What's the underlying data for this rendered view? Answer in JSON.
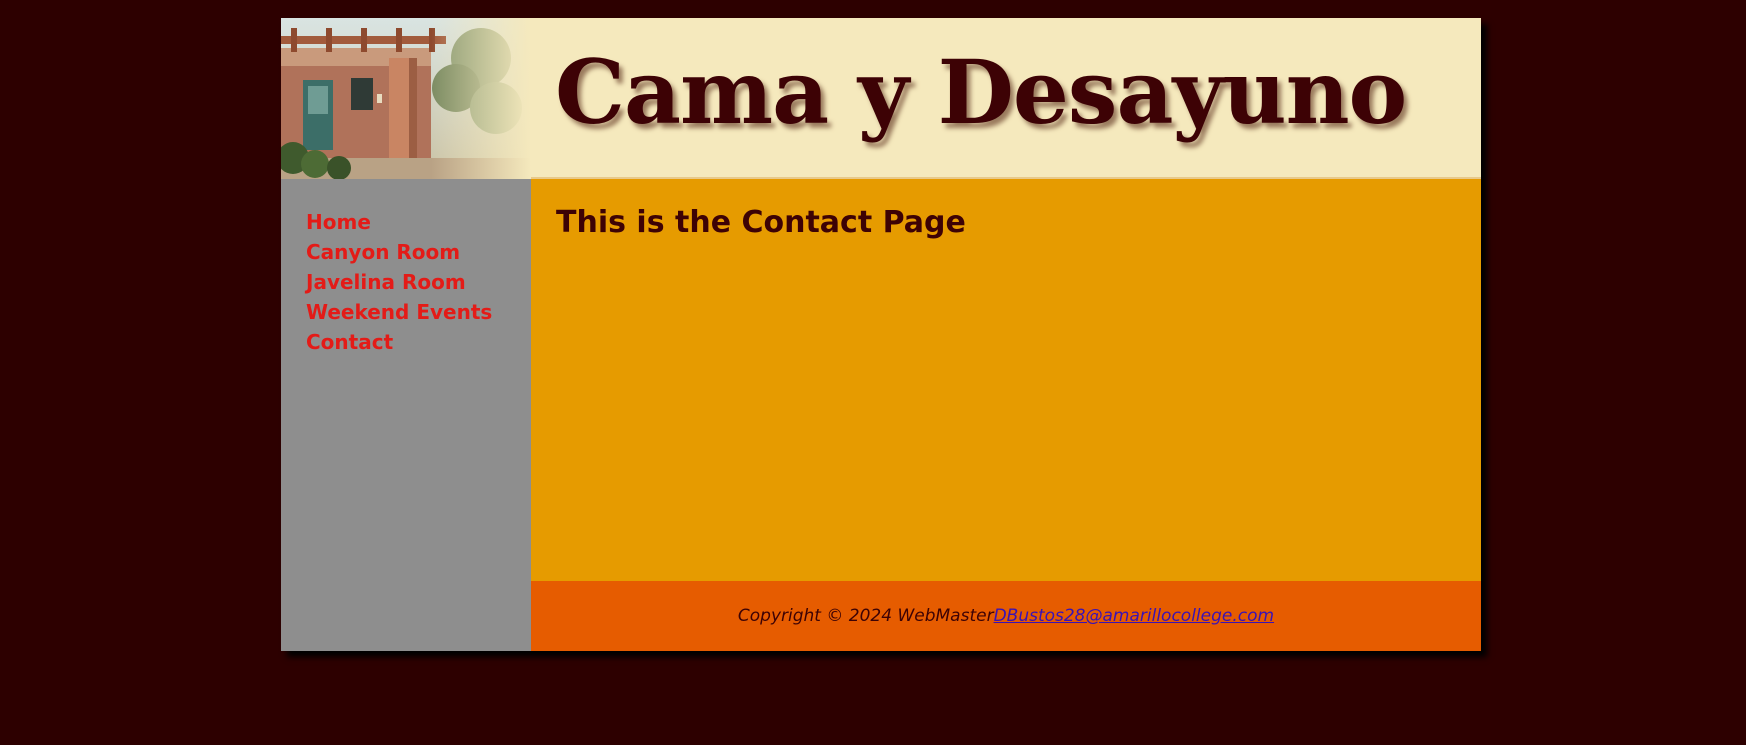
{
  "header": {
    "title": "Cama y Desayuno",
    "photo_icon": "house-photo"
  },
  "sidebar": {
    "items": [
      {
        "label": "Home"
      },
      {
        "label": "Canyon Room"
      },
      {
        "label": "Javelina Room"
      },
      {
        "label": "Weekend Events"
      },
      {
        "label": "Contact"
      }
    ]
  },
  "main": {
    "heading": "This is the Contact Page"
  },
  "footer": {
    "copyright": "Copyright © 2024 WebMaster",
    "email": "DBustos28@amarillocollege.com"
  },
  "colors": {
    "page_background": "#2d0000",
    "header_background": "#f5e9bd",
    "title_color": "#3d0205",
    "sidebar_background": "#8e8e8e",
    "nav_link": "#e41b17",
    "main_background": "#e69b00",
    "footer_background": "#e65c00",
    "footer_link": "#3a12b5"
  }
}
